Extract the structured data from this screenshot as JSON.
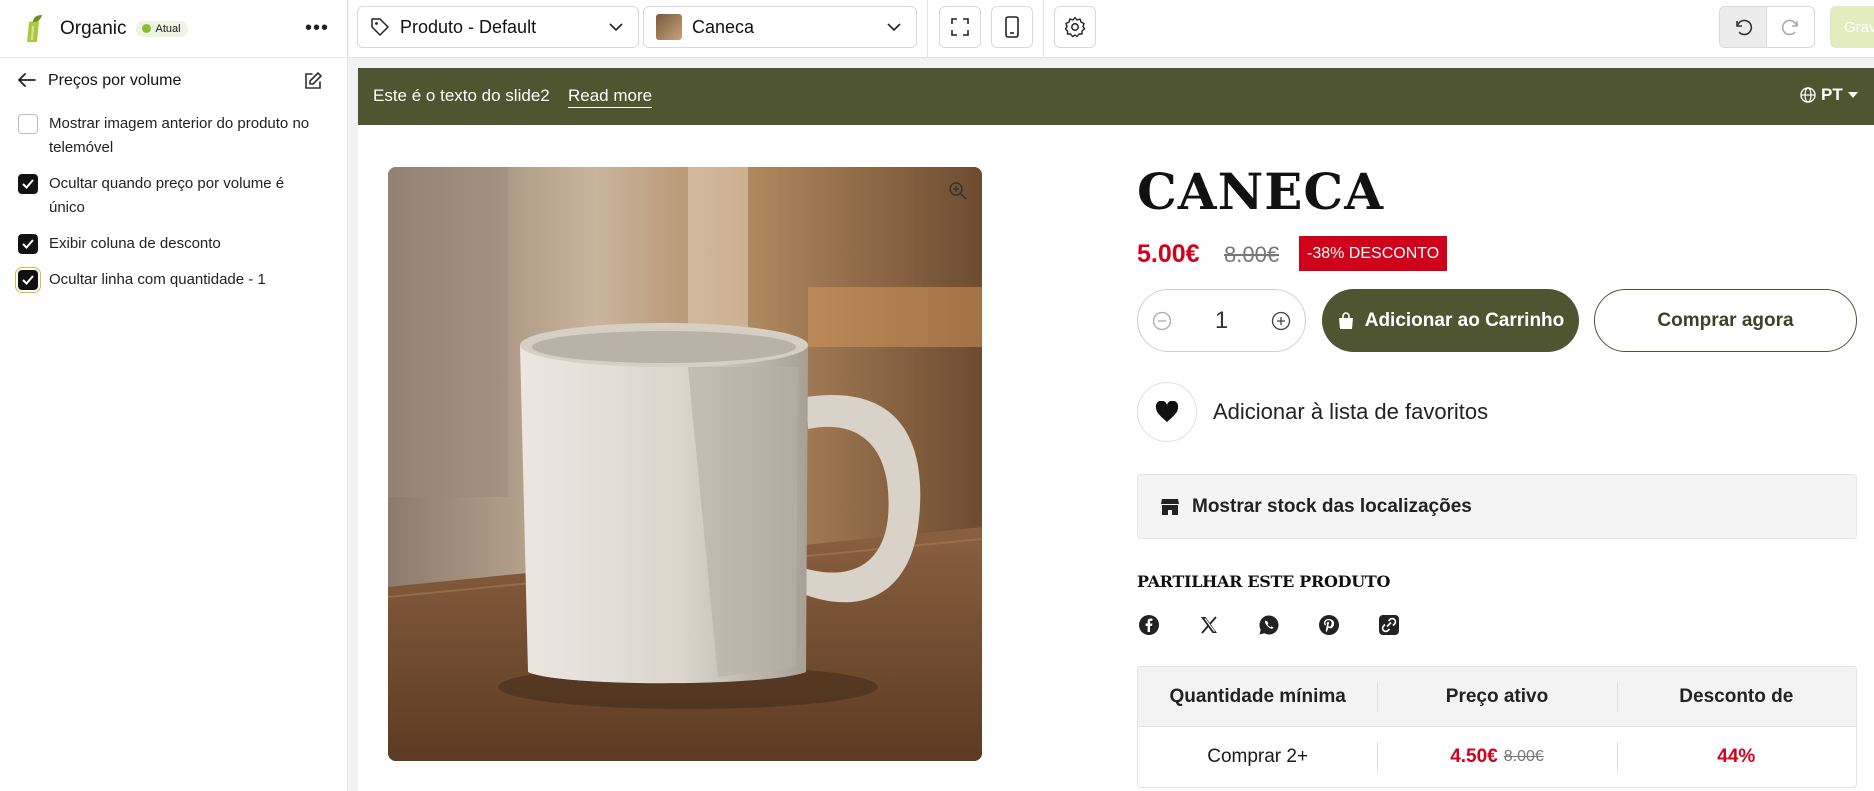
{
  "app": {
    "name": "Organic",
    "status_badge": "Atual"
  },
  "sidebar": {
    "title": "Preços por volume",
    "options": [
      {
        "label": "Mostrar imagem anterior do produto no telemóvel",
        "checked": false
      },
      {
        "label": "Ocultar quando preço por volume é único",
        "checked": true
      },
      {
        "label": "Exibir coluna de desconto",
        "checked": true
      },
      {
        "label": "Ocultar linha com quantidade - 1",
        "checked": true
      }
    ]
  },
  "toolbar": {
    "template_select": "Produto - Default",
    "product_select": "Caneca",
    "save_label": "Gravar"
  },
  "announcement": {
    "text": "Este é o texto do slide2",
    "link": "Read more",
    "language": "PT"
  },
  "product": {
    "title": "CANECA",
    "price": "5.00€",
    "compare_price": "8.00€",
    "discount_badge": "-38% DESCONTO",
    "quantity": "1",
    "add_to_cart": "Adicionar ao Carrinho",
    "buy_now": "Comprar agora",
    "wishlist": "Adicionar à lista de favoritos",
    "stock_button": "Mostrar stock das localizações",
    "share_title": "PARTILHAR ESTE PRODUTO",
    "share_icons": [
      "facebook-icon",
      "x-icon",
      "whatsapp-icon",
      "pinterest-icon",
      "copy-link-icon"
    ]
  },
  "volume_table": {
    "headers": [
      "Quantidade mínima",
      "Preço ativo",
      "Desconto de"
    ],
    "rows": [
      {
        "quantity": "Comprar 2+",
        "price": "4.50€",
        "compare_price": "8.00€",
        "discount": "44%"
      }
    ]
  },
  "colors": {
    "brand_olive": "#4f5531",
    "sale_red": "#d0021b",
    "status_green": "#8bbd2c"
  }
}
